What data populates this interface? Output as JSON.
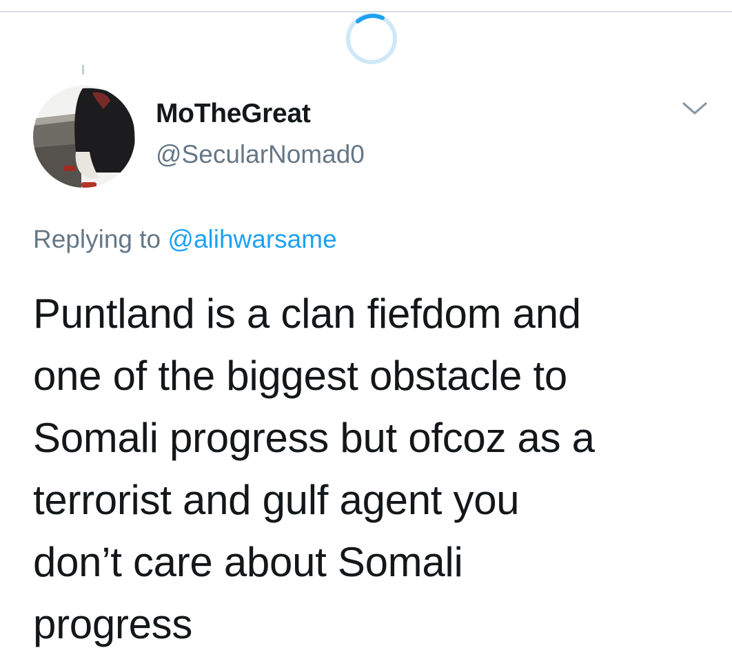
{
  "tweet": {
    "author": {
      "display_name": "MoTheGreat",
      "handle": "@SecularNomad0"
    },
    "reply": {
      "prefix": "Replying to",
      "target": "@alihwarsame"
    },
    "text_lines": [
      "Puntland is a clan fiefdom and",
      "one of the biggest obstacle to",
      "Somali progress but ofcoz as a",
      "terrorist and gulf agent you",
      "don’t care about Somali",
      "progress"
    ]
  },
  "icons": {
    "loading": "loading-spinner-icon",
    "menu": "chevron-down-icon",
    "avatar": "profile-photo"
  },
  "colors": {
    "text": "#14171a",
    "secondary": "#657786",
    "link": "#1da1f2",
    "divider": "#d6dce1"
  }
}
